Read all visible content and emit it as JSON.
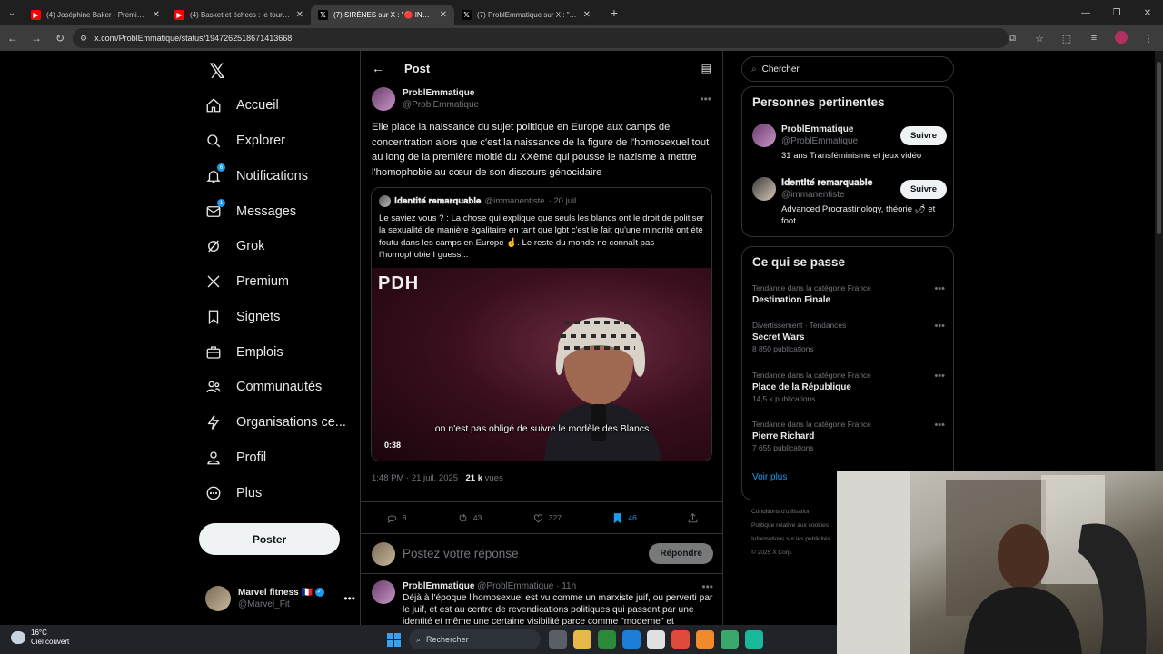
{
  "browser": {
    "tabs": [
      {
        "label": "(4) Joséphine Baker - Première",
        "favicon": "youtube-icon",
        "active": false
      },
      {
        "label": "(4) Basket et échecs : le tournoi",
        "favicon": "youtube-icon",
        "active": false
      },
      {
        "label": "(7) SIRÈNES sur X : \"🔴 INSOLITE",
        "favicon": "x-icon",
        "active": true
      },
      {
        "label": "(7) ProblEmmatique sur X : \"Elle",
        "favicon": "x-icon",
        "active": false
      }
    ],
    "url": "x.com/ProblEmmatique/status/1947262518671413668"
  },
  "nav": {
    "items": [
      {
        "label": "Accueil",
        "icon": "home-icon"
      },
      {
        "label": "Explorer",
        "icon": "search-icon"
      },
      {
        "label": "Notifications",
        "icon": "bell-icon",
        "badge": "6"
      },
      {
        "label": "Messages",
        "icon": "mail-icon",
        "badge": "1"
      },
      {
        "label": "Grok",
        "icon": "grok-icon"
      },
      {
        "label": "Premium",
        "icon": "x-icon"
      },
      {
        "label": "Signets",
        "icon": "bookmark-icon"
      },
      {
        "label": "Emplois",
        "icon": "briefcase-icon"
      },
      {
        "label": "Communautés",
        "icon": "people-icon"
      },
      {
        "label": "Organisations ce...",
        "icon": "lightning-icon"
      },
      {
        "label": "Profil",
        "icon": "person-icon"
      },
      {
        "label": "Plus",
        "icon": "more-circle-icon"
      }
    ],
    "post_button": "Poster",
    "account": {
      "name": "Marvel fitness 🇫🇷",
      "handle": "@Marvel_Fit"
    }
  },
  "post": {
    "header_title": "Post",
    "author": {
      "name": "ProblEmmatique",
      "handle": "@ProblEmmatique"
    },
    "text": "Elle place la naissance du sujet politique en Europe aux camps de concentration alors que c'est la naissance de la figure de l'homosexuel tout au long de la première moitié du XXème qui pousse le nazisme à mettre l'homophobie au cœur de son discours génocidaire",
    "quote": {
      "name": "𝐈𝐝𝐞𝐧𝐭𝐢𝐭𝐞́ 𝐫𝐞𝐦𝐚𝐫𝐪𝐮𝐚𝐛𝐥𝐞",
      "handle": "@immanentiste",
      "date": "· 20 juil.",
      "text": "Le saviez vous ? : La chose qui explique que seuls les blancs ont le droit de politiser la sexualité de manière égalitaire en tant que lgbt c'est le fait qu'une minorité ont été foutu dans les camps en Europe ☝️. Le reste du monde ne connaît pas l'homophobie I guess...",
      "video": {
        "logo": "PDH",
        "subtitle": "on n'est pas obligé de suivre le modèle des Blancs.",
        "duration": "0:38"
      }
    },
    "timestamp": "1:48 PM · 21 juil. 2025 · ",
    "views_count": "21 k",
    "views_label": " vues",
    "actions": {
      "replies": "8",
      "reposts": "43",
      "likes": "327",
      "bookmarks": "46"
    },
    "reply_placeholder": "Postez votre réponse",
    "reply_button": "Répondre"
  },
  "next_tweet": {
    "name": "ProblEmmatique",
    "handle": "@ProblEmmatique · 11h",
    "text": "Déjà à l'époque l'homosexuel est vu comme un marxiste juif, ou perverti par le juif, et est au centre de revendications politiques qui passent par une identité et même une certaine visibilité parce comme \"moderne\" et"
  },
  "sidebar": {
    "search_placeholder": "Chercher",
    "relevant": {
      "title": "Personnes pertinentes",
      "people": [
        {
          "name": "ProblEmmatique",
          "handle": "@ProblEmmatique",
          "bio": "31 ans Transféminisme et jeux vidéo",
          "button": "Suivre"
        },
        {
          "name": "𝐈𝐝𝐞𝐧𝐭𝐢𝐭𝐞́ 𝐫𝐞𝐦𝐚𝐫𝐪𝐮𝐚𝐛𝐥𝐞",
          "handle": "@immanentiste",
          "bio": "Advanced Procrastinology, théorie 🌶 et foot",
          "button": "Suivre"
        }
      ]
    },
    "trends": {
      "title": "Ce qui se passe",
      "items": [
        {
          "context": "Tendance dans la catégorie France",
          "title": "Destination Finale",
          "count": ""
        },
        {
          "context": "Divertissement · Tendances",
          "title": "Secret Wars",
          "count": "8 850 publications"
        },
        {
          "context": "Tendance dans la catégorie France",
          "title": "Place de la République",
          "count": "14,5 k publications"
        },
        {
          "context": "Tendance dans la catégorie France",
          "title": "Pierre Richard",
          "count": "7 655 publications"
        }
      ],
      "more": "Voir plus"
    },
    "footer": [
      "Conditions d'utilisation",
      "Politique relative aux cookies",
      "Informations sur les publicités",
      "© 2025 X Corp."
    ]
  },
  "taskbar": {
    "temp": "16°C",
    "weather": "Ciel couvert",
    "search": "Rechercher"
  }
}
